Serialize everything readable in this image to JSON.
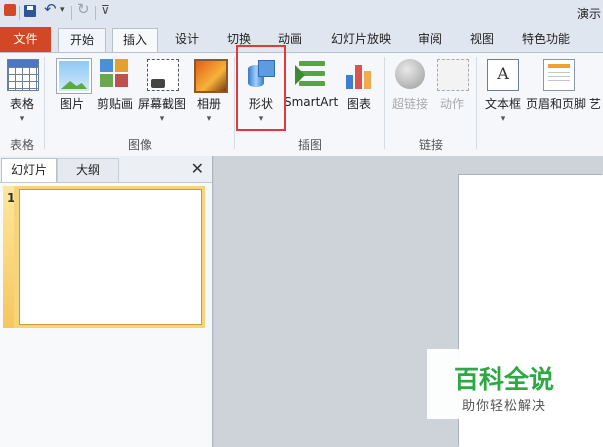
{
  "window": {
    "title": "演示"
  },
  "quick_access": {
    "icons": [
      "app-logo-icon",
      "save-icon",
      "undo-icon",
      "redo-icon",
      "customize-icon"
    ]
  },
  "tabs": [
    {
      "label": "文件"
    },
    {
      "label": "开始"
    },
    {
      "label": "插入"
    },
    {
      "label": "设计"
    },
    {
      "label": "切换"
    },
    {
      "label": "动画"
    },
    {
      "label": "幻灯片放映"
    },
    {
      "label": "审阅"
    },
    {
      "label": "视图"
    },
    {
      "label": "特色功能"
    }
  ],
  "active_tab": "插入",
  "ribbon": {
    "groups": {
      "tables": "表格",
      "images": "图像",
      "illustrations": "插图",
      "links": "链接"
    },
    "buttons": {
      "table": "表格",
      "picture": "图片",
      "clipart": "剪贴画",
      "screenshot": "屏幕截图",
      "album": "相册",
      "shapes": "形状",
      "smartart": "SmartArt",
      "chart": "图表",
      "hyperlink": "超链接",
      "action": "动作",
      "textbox": "文本框",
      "header_footer": "页眉和页脚",
      "art": "艺"
    },
    "dropdown_glyph": "▾"
  },
  "slides_pane": {
    "tabs": [
      "幻灯片",
      "大纲"
    ],
    "close_glyph": "✕",
    "slide_number": "1"
  },
  "watermark": {
    "title": "百科全说",
    "subtitle": "助你轻松解决"
  },
  "colors": {
    "file_tab": "#d24726",
    "highlight": "#e03a3a",
    "watermark": "#2da843"
  }
}
